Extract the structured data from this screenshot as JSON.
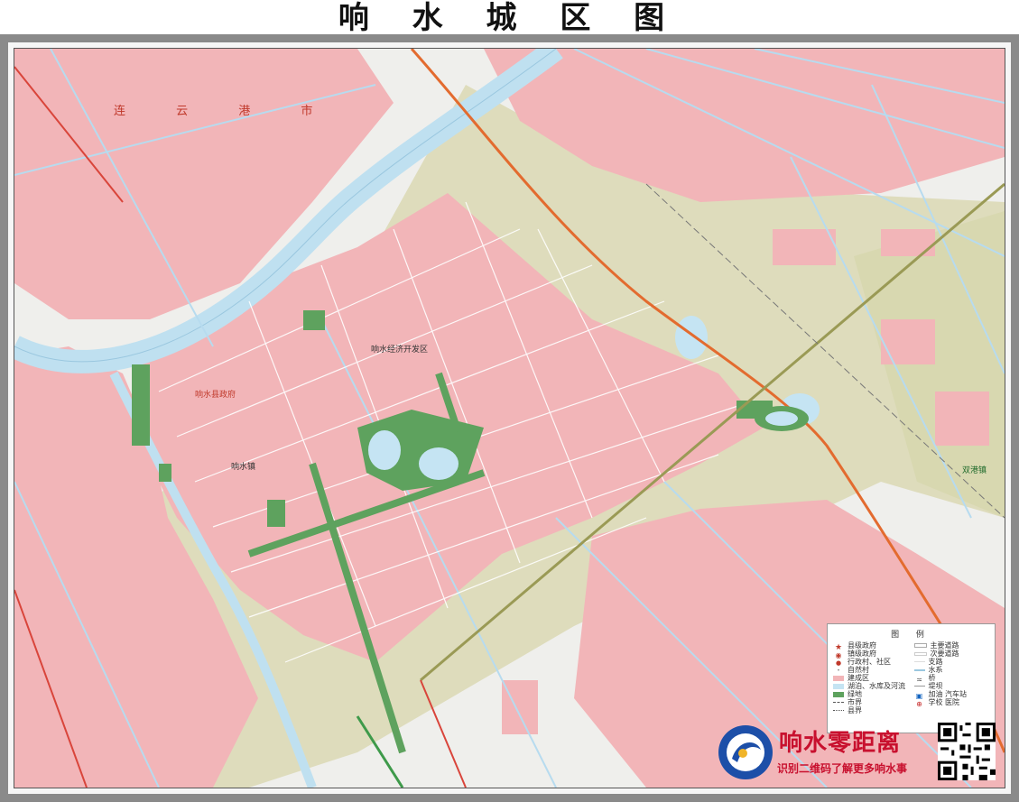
{
  "title": "响 水 城 区 图",
  "labels": {
    "city_region": "连 云 港 市",
    "county_gov": "响水县政府",
    "dev_zone": "响水经济开发区",
    "town_a": "响水镇",
    "town_b": "双港镇"
  },
  "legend": {
    "title": "图 例",
    "left_items": [
      "县级政府",
      "镇级政府",
      "行政村、社区",
      "自然村",
      "建成区",
      "湖泊、水库及河流",
      "绿地",
      "市界",
      "县界"
    ],
    "right_items": [
      "主要道路",
      "次要道路",
      "支路",
      "水系",
      "桥",
      "堤坝",
      "加油  汽车站",
      "学校  医院"
    ]
  },
  "brand": {
    "name": "响水零距离",
    "subtitle": "识别二维码了解更多响水事"
  },
  "colors": {
    "built_up": "#f2b5b8",
    "agri": "#dcdcb8",
    "water": "#c5e4f3",
    "green": "#5ea25e",
    "rail": "#e36b2f"
  }
}
